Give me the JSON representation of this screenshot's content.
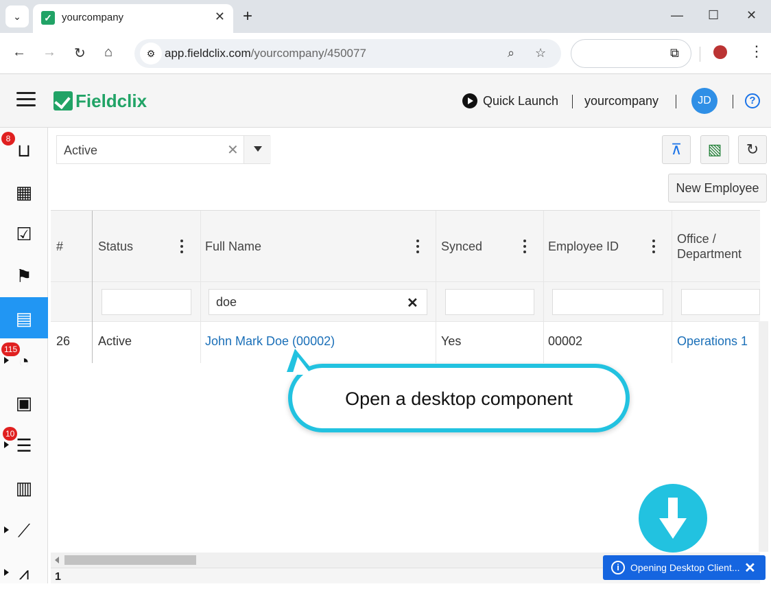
{
  "browser": {
    "tab_title": "yourcompany",
    "url_host": "app.fieldclix.com",
    "url_path": "/yourcompany/450077",
    "new_tab": "+",
    "tab_close": "✕"
  },
  "header": {
    "logo_text": "Fieldclix",
    "quick_launch": "Quick Launch",
    "company": "yourcompany",
    "avatar_initials": "JD",
    "help": "?"
  },
  "sidebar": {
    "badges": {
      "inbox": "8",
      "timesheets": "115",
      "invoices": "10"
    },
    "active_item": "employees"
  },
  "toolbar": {
    "status_filter": "Active",
    "new_employee": "New Employee"
  },
  "grid": {
    "columns": [
      "#",
      "Status",
      "Full Name",
      "Synced",
      "Employee ID",
      "Office /",
      "Department"
    ],
    "filters": {
      "full_name": "doe"
    },
    "rows": [
      {
        "num": "26",
        "status": "Active",
        "full_name": "John Mark Doe (00002)",
        "synced": "Yes",
        "employee_id": "00002",
        "office": "Operations 1"
      }
    ],
    "footer_num": "1"
  },
  "callout": {
    "text": "Open a desktop component"
  },
  "toast": {
    "text": "Opening Desktop Client...",
    "icon": "i",
    "close": "✕"
  },
  "colors": {
    "brand": "#21a366",
    "active": "#2196f3",
    "callout": "#22c2e0",
    "toast": "#1565e0",
    "badge": "#e02020",
    "link": "#1a6fb8"
  }
}
